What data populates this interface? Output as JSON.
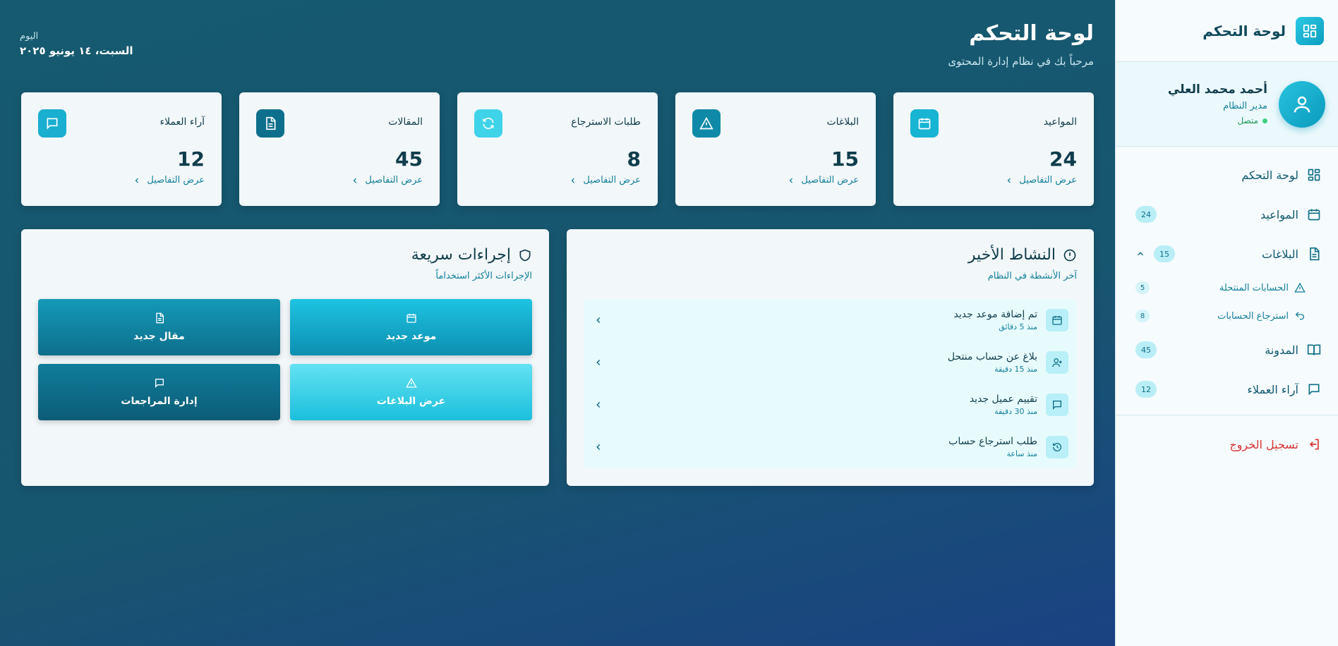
{
  "sidebar": {
    "title": "لوحة التحكم",
    "profile": {
      "name": "أحمد محمد العلي",
      "role": "مدير النظام",
      "status": "متصل"
    },
    "nav": {
      "dashboard": {
        "label": "لوحة التحكم",
        "icon": "grid-icon"
      },
      "appointments": {
        "label": "المواعيد",
        "badge": "24",
        "icon": "calendar-icon"
      },
      "reports": {
        "label": "البلاغات",
        "badge": "15",
        "icon": "document-icon",
        "sub": [
          {
            "label": "الحسابات المنتحلة",
            "badge": "5",
            "icon": "warning-icon"
          },
          {
            "label": "استرجاع الحسابات",
            "badge": "8",
            "icon": "undo-icon"
          }
        ]
      },
      "blog": {
        "label": "المدونة",
        "badge": "45",
        "icon": "book-icon"
      },
      "reviews": {
        "label": "آراء العملاء",
        "badge": "12",
        "icon": "message-icon"
      }
    },
    "logout": "تسجيل الخروج"
  },
  "header": {
    "title": "لوحة التحكم",
    "subtitle": "مرحباً بك في نظام إدارة المحتوى",
    "date_label": "اليوم",
    "date_value": "السبت، ١٤ يونيو ٢٠٢٥"
  },
  "stats": [
    {
      "title": "المواعيد",
      "value": "24",
      "link": "عرض التفاصيل",
      "icon": "calendar-icon",
      "color": "#17b4d4"
    },
    {
      "title": "البلاغات",
      "value": "15",
      "link": "عرض التفاصيل",
      "icon": "warning-icon",
      "color": "#0e8aa8"
    },
    {
      "title": "طلبات الاسترجاع",
      "value": "8",
      "link": "عرض التفاصيل",
      "icon": "refresh-icon",
      "color": "#3fd3ea"
    },
    {
      "title": "المقالات",
      "value": "45",
      "link": "عرض التفاصيل",
      "icon": "document-icon",
      "color": "#0d6f8c"
    },
    {
      "title": "آراء العملاء",
      "value": "12",
      "link": "عرض التفاصيل",
      "icon": "message-icon",
      "color": "#1aaed0"
    }
  ],
  "activity": {
    "title": "النشاط الأخير",
    "subtitle": "آخر الأنشطة في النظام",
    "items": [
      {
        "title": "تم إضافة موعد جديد",
        "time": "منذ 5 دقائق",
        "icon": "calendar-icon"
      },
      {
        "title": "بلاغ عن حساب منتحل",
        "time": "منذ 15 دقيقة",
        "icon": "user-plus-icon"
      },
      {
        "title": "تقييم عميل جديد",
        "time": "منذ 30 دقيقة",
        "icon": "message-icon"
      },
      {
        "title": "طلب استرجاع حساب",
        "time": "منذ ساعة",
        "icon": "history-icon"
      }
    ]
  },
  "actions": {
    "title": "إجراءات سريعة",
    "subtitle": "الإجراءات الأكثر استخداماً",
    "buttons": [
      {
        "label": "موعد جديد",
        "icon": "calendar-icon"
      },
      {
        "label": "مقال جديد",
        "icon": "document-icon"
      },
      {
        "label": "عرض البلاغات",
        "icon": "warning-icon"
      },
      {
        "label": "إدارة المراجعات",
        "icon": "message-icon"
      }
    ]
  },
  "colors": {
    "accent": "#12809c",
    "danger": "#d83434",
    "badge_bg": "#b9eef7"
  }
}
